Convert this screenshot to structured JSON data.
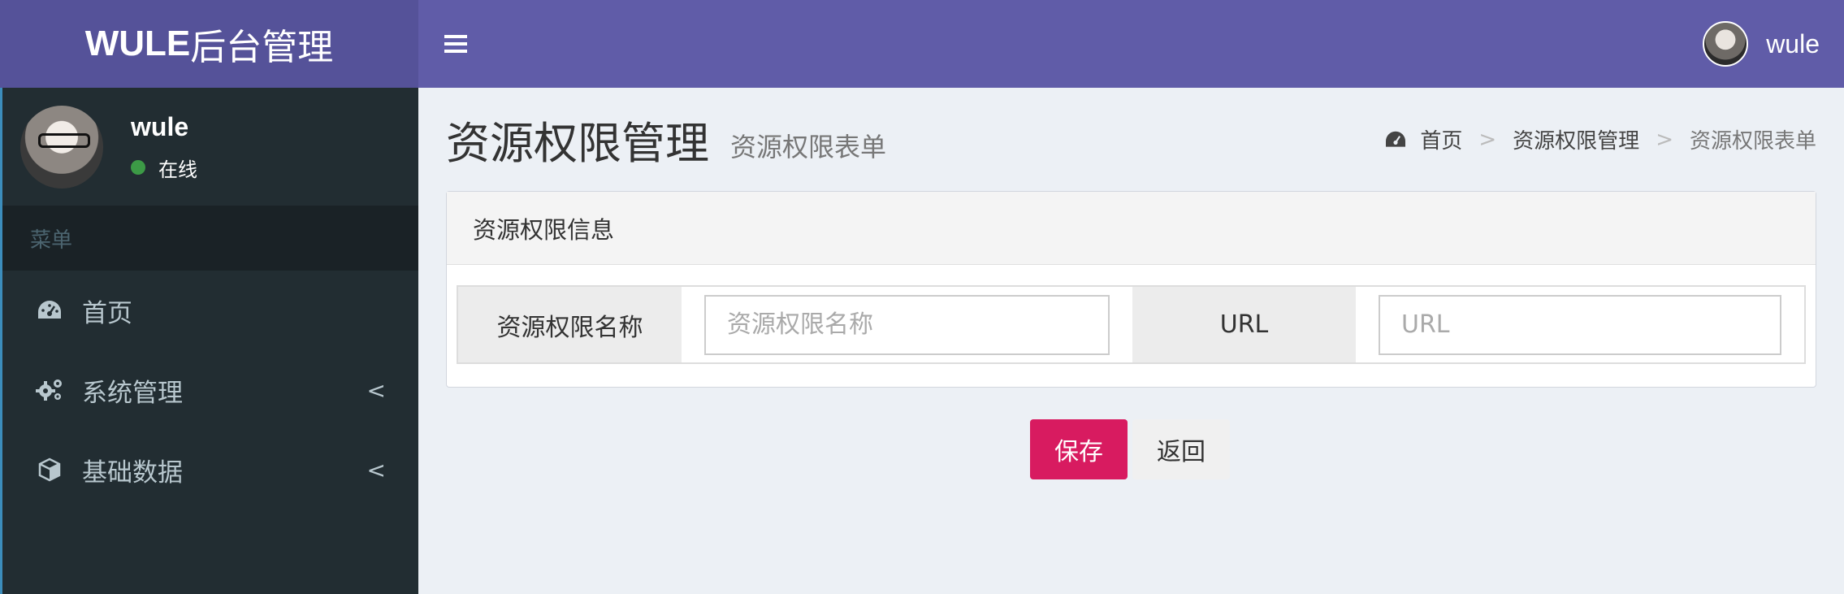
{
  "header": {
    "logo_bold": "WULE",
    "logo_rest": "后台管理",
    "toggle_icon": "≡",
    "username": "wule"
  },
  "sidebar": {
    "user": {
      "name": "wule",
      "status": "在线"
    },
    "menu_header": "菜单",
    "items": [
      {
        "label": "首页",
        "icon": "dashboard-icon",
        "has_children": false
      },
      {
        "label": "系统管理",
        "icon": "gears-icon",
        "has_children": true,
        "chevron": "<"
      },
      {
        "label": "基础数据",
        "icon": "cube-icon",
        "has_children": true,
        "chevron": "<"
      }
    ]
  },
  "page": {
    "title": "资源权限管理",
    "subtitle": "资源权限表单",
    "breadcrumb": [
      "首页",
      "资源权限管理",
      "资源权限表单"
    ],
    "breadcrumb_sep": ">"
  },
  "form": {
    "box_title": "资源权限信息",
    "fields": [
      {
        "label": "资源权限名称",
        "value": "",
        "placeholder": "资源权限名称"
      },
      {
        "label": "URL",
        "value": "",
        "placeholder": "URL"
      }
    ],
    "save_label": "保存",
    "back_label": "返回"
  },
  "colors": {
    "header_bg": "#605ca8",
    "logo_bg": "#555299",
    "sidebar_bg": "#222d32",
    "save_button": "#d81b60",
    "status_online": "#3c9a46"
  }
}
